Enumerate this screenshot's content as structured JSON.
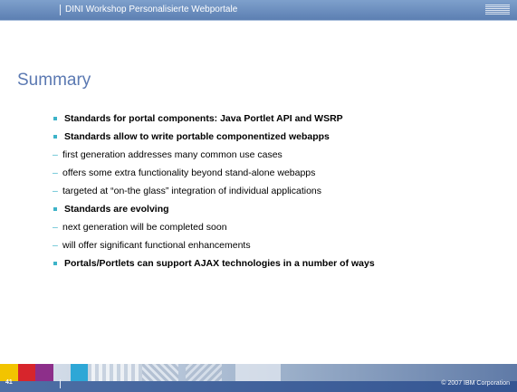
{
  "header": {
    "title": "DINI Workshop Personalisierte Webportale",
    "logo_text": "IBM",
    "background": "#5c7fb2"
  },
  "slide": {
    "title": "Summary",
    "bullets": [
      {
        "level": 1,
        "text": "Standards for portal components: Java Portlet API and WSRP"
      },
      {
        "level": 1,
        "text": "Standards allow to write portable componentized webapps"
      },
      {
        "level": 2,
        "text": "first generation addresses many common use cases"
      },
      {
        "level": 2,
        "text": "offers some extra functionality beyond stand-alone webapps"
      },
      {
        "level": 2,
        "text": "targeted at “on-the glass” integration of individual applications"
      },
      {
        "level": 1,
        "text": "Standards are evolving"
      },
      {
        "level": 2,
        "text": "next generation will be completed soon"
      },
      {
        "level": 2,
        "text": "will offer significant functional enhancements"
      },
      {
        "level": 1,
        "text": "Portals/Portlets can support AJAX technologies in a number of ways"
      }
    ]
  },
  "footer": {
    "page_number": "41",
    "copyright": "© 2007 IBM Corporation",
    "color_blocks": [
      "#f2c400",
      "#d7252c",
      "#8d2f8a",
      "#2ea7d6"
    ]
  },
  "colors": {
    "title": "#5b79b2",
    "bullet": "#3db3c8"
  }
}
